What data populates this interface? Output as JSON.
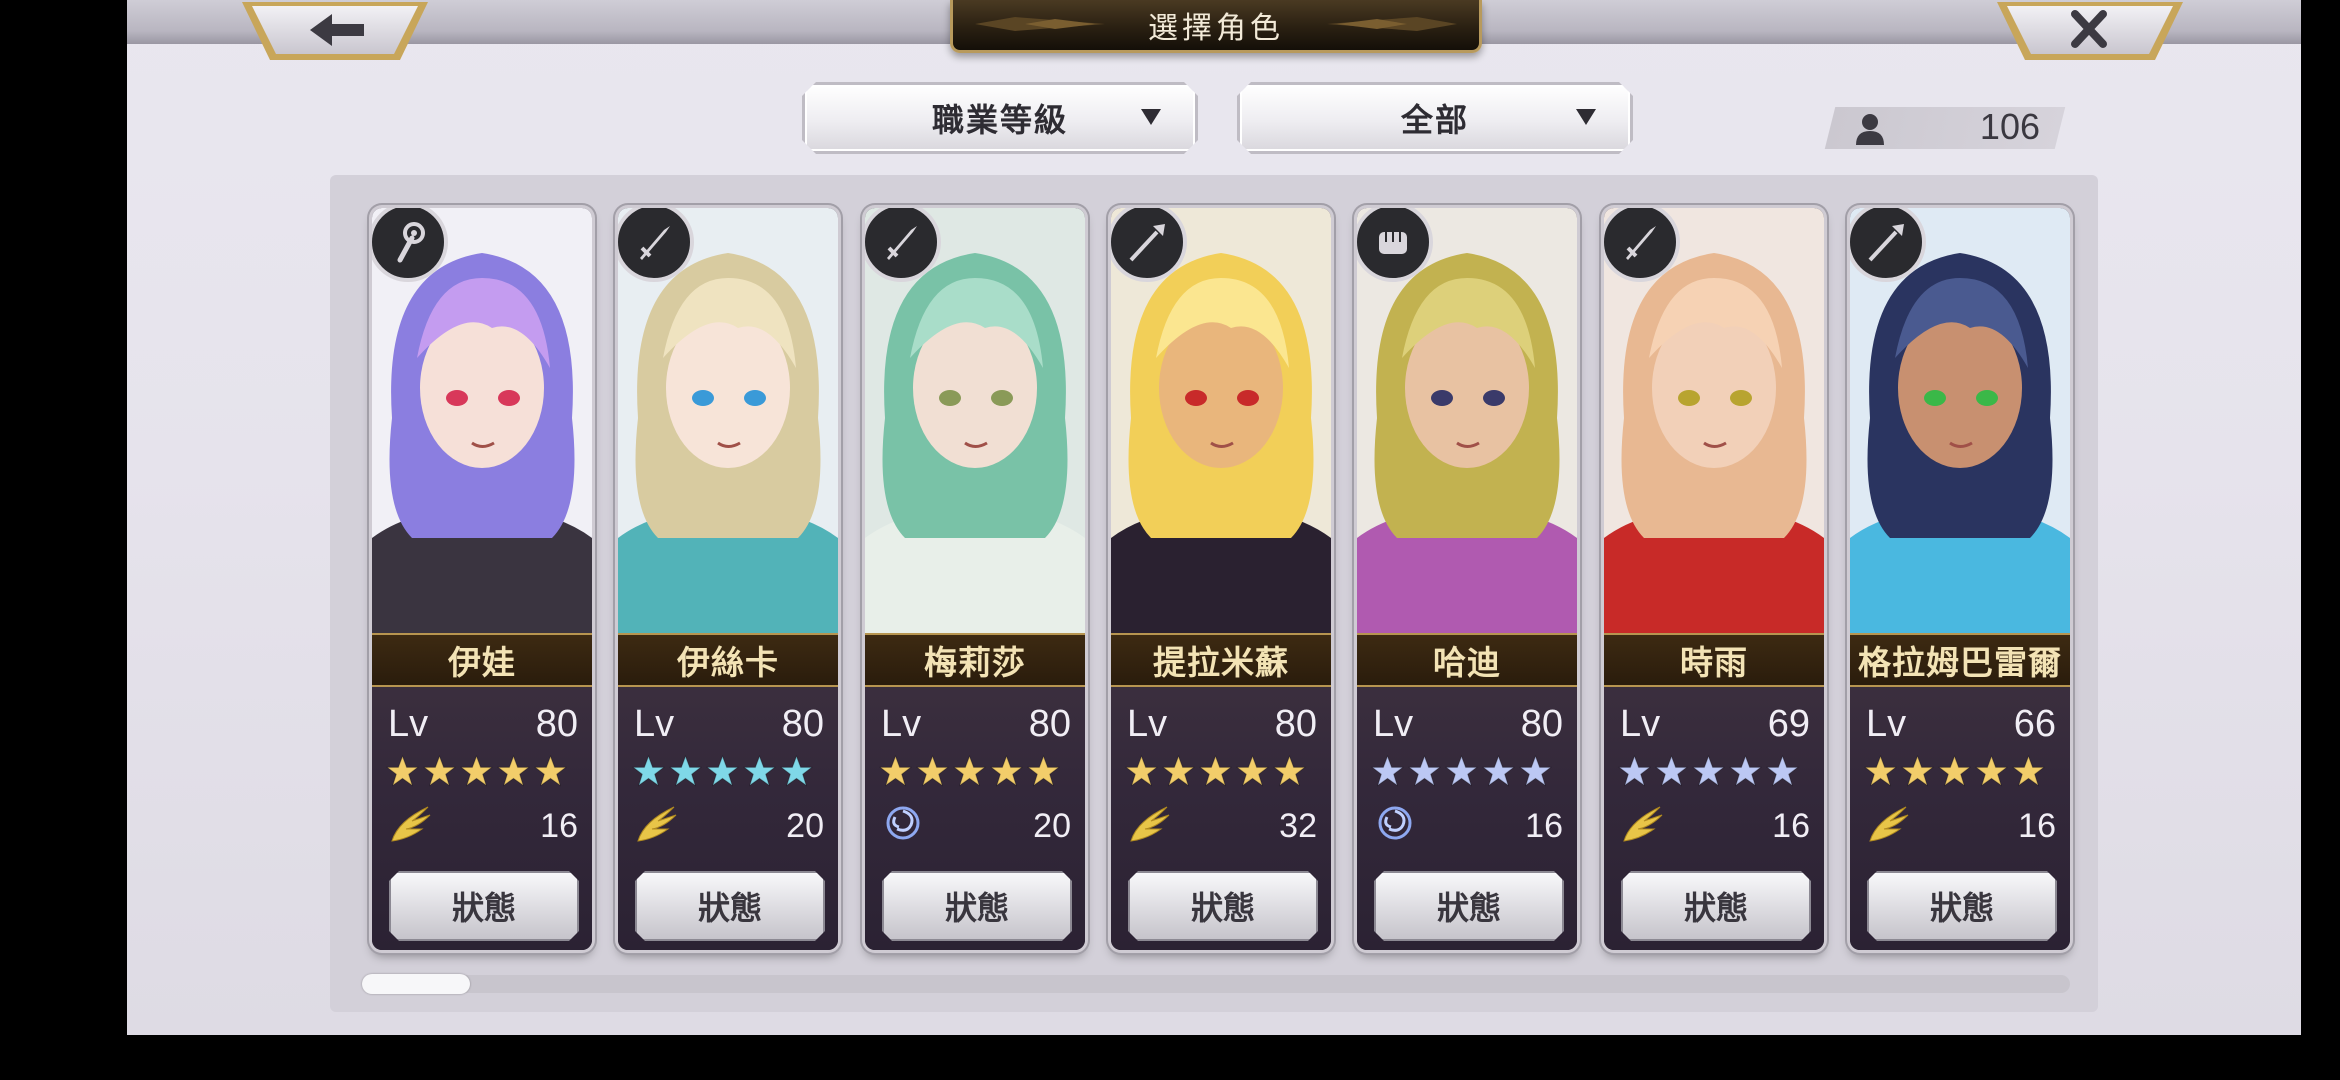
{
  "header": {
    "title": "選擇角色",
    "back_icon": "back-arrow-icon",
    "close_icon": "close-icon"
  },
  "filters": {
    "job_dropdown": {
      "selected": "職業等級"
    },
    "category_dropdown": {
      "selected": "全部"
    }
  },
  "unit_count": {
    "icon": "person-icon",
    "value": "106"
  },
  "characters": [
    {
      "name": "伊娃",
      "level_label": "Lv",
      "level": "80",
      "stars": 5,
      "star_color": "#f2cd6a",
      "element_icon": "wing-icon",
      "stat": "16",
      "status_label": "狀態",
      "class_icon": "staff-icon",
      "palette": {
        "bg": "#f1f0f6",
        "hair": "#8b7ee0",
        "hair2": "#c49cf0",
        "skin": "#f6e0d8",
        "outfit": "#3a3440",
        "eyes": "#d8385a"
      }
    },
    {
      "name": "伊絲卡",
      "level_label": "Lv",
      "level": "80",
      "stars": 5,
      "star_color": "#7fd8e8",
      "element_icon": "wing-icon",
      "stat": "20",
      "status_label": "狀態",
      "class_icon": "sword-icon",
      "palette": {
        "bg": "#e8eef2",
        "hair": "#d8cba0",
        "hair2": "#efe3c0",
        "skin": "#f7e4d8",
        "outfit": "#52b3b8",
        "eyes": "#3a9ad8"
      }
    },
    {
      "name": "梅莉莎",
      "level_label": "Lv",
      "level": "80",
      "stars": 5,
      "star_color": "#f2cd6a",
      "element_icon": "swirl-icon",
      "stat": "20",
      "status_label": "狀態",
      "class_icon": "sword-icon",
      "palette": {
        "bg": "#dfe8e4",
        "hair": "#79c2a7",
        "hair2": "#a9ddc9",
        "skin": "#f1dfd3",
        "outfit": "#e8efe9",
        "eyes": "#8a9a58"
      }
    },
    {
      "name": "提拉米蘇",
      "level_label": "Lv",
      "level": "80",
      "stars": 5,
      "star_color": "#f2cd6a",
      "element_icon": "wing-icon",
      "stat": "32",
      "status_label": "狀態",
      "class_icon": "spear-icon",
      "palette": {
        "bg": "#eee8d8",
        "hair": "#f2cf58",
        "hair2": "#fbe690",
        "skin": "#e9b67c",
        "outfit": "#2a2130",
        "eyes": "#c82a2a"
      }
    },
    {
      "name": "哈迪",
      "level_label": "Lv",
      "level": "80",
      "stars": 5,
      "star_color": "#bcc8f4",
      "element_icon": "swirl-icon",
      "stat": "16",
      "status_label": "狀態",
      "class_icon": "fist-icon",
      "palette": {
        "bg": "#ece8e2",
        "hair": "#c2b250",
        "hair2": "#ddd07a",
        "skin": "#e8c2a2",
        "outfit": "#b05ab0",
        "eyes": "#3a3a6a"
      }
    },
    {
      "name": "時雨",
      "level_label": "Lv",
      "level": "69",
      "stars": 5,
      "star_color": "#bcc8f4",
      "element_icon": "wing-icon",
      "stat": "16",
      "status_label": "狀態",
      "class_icon": "sword-icon",
      "palette": {
        "bg": "#f0e6e0",
        "hair": "#e8b892",
        "hair2": "#f6d2b4",
        "skin": "#f2d0b8",
        "outfit": "#c82a28",
        "eyes": "#b8a430"
      }
    },
    {
      "name": "格拉姆巴雷爾",
      "level_label": "Lv",
      "level": "66",
      "stars": 5,
      "star_color": "#f2cd6a",
      "element_icon": "wing-icon",
      "stat": "16",
      "status_label": "狀態",
      "class_icon": "spear-icon",
      "palette": {
        "bg": "#dfeaf4",
        "hair": "#2a3460",
        "hair2": "#4a5a90",
        "skin": "#c89070",
        "outfit": "#4ab8e0",
        "eyes": "#3ab848"
      }
    }
  ],
  "scrollbar": {
    "position": 0
  }
}
